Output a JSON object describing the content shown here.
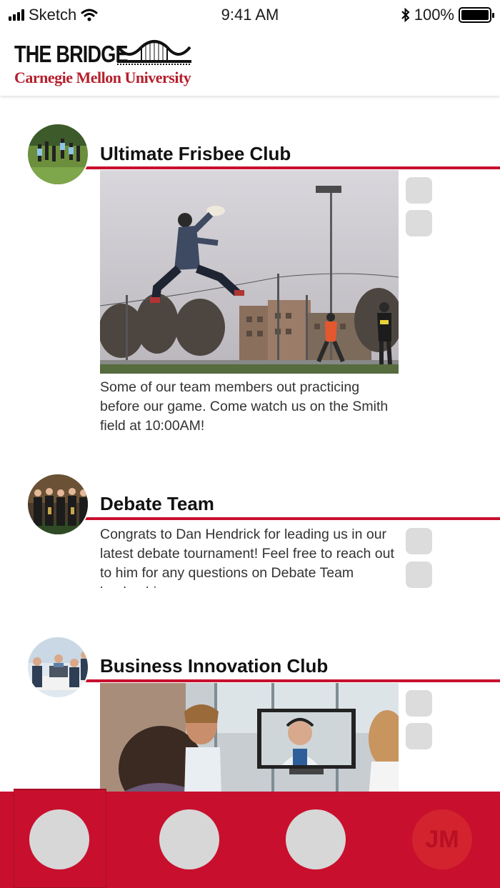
{
  "status_bar": {
    "carrier": "Sketch",
    "time": "9:41 AM",
    "battery": "100%"
  },
  "header": {
    "logo_title": "THE BRIDGE",
    "logo_subtitle": "Carnegie Mellon University"
  },
  "posts": [
    {
      "club": "Ultimate Frisbee Club",
      "caption": "Some of our team members out practicing before our game. Come watch us on the Smith field at 10:00AM!"
    },
    {
      "club": "Debate Team",
      "caption": "Congrats to Dan Hendrick for leading us in our latest debate tournament! Feel free to reach out to him for any questions on Debate Team leadership"
    },
    {
      "club": "Business Innovation Club",
      "caption": ""
    }
  ],
  "tab_bar": {
    "profile_initials": "JM"
  },
  "colors": {
    "accent": "#c8102e",
    "placeholder": "#dcdcdc"
  }
}
